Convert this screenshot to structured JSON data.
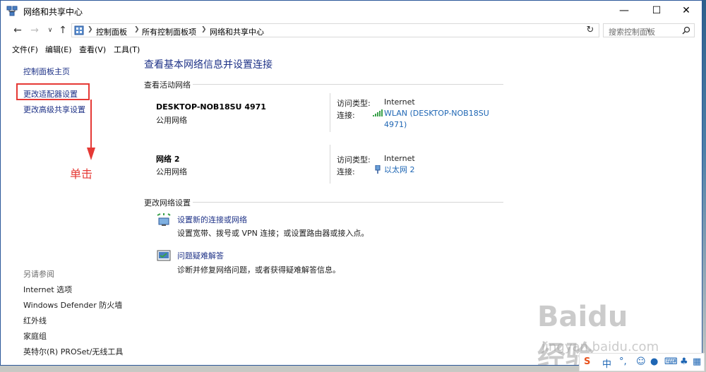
{
  "window": {
    "title": "网络和共享中心"
  },
  "address": {
    "crumbs": [
      "控制面板",
      "所有控制面板项",
      "网络和共享中心"
    ],
    "search_placeholder": "搜索控制面板"
  },
  "menu": [
    "文件(F)",
    "编辑(E)",
    "查看(V)",
    "工具(T)"
  ],
  "sidebar": {
    "home": "控制面板主页",
    "adapter": "更改适配器设置",
    "advanced_share": "更改高级共享设置",
    "see_also_head": "另请参阅",
    "see_also": [
      "Internet 选项",
      "Windows Defender 防火墙",
      "红外线",
      "家庭组",
      "英特尔(R) PROSet/无线工具"
    ]
  },
  "annotation": {
    "click_label": "单击",
    "color": "#e53935"
  },
  "main": {
    "title": "查看基本网络信息并设置连接",
    "active_head": "查看活动网络",
    "networks": [
      {
        "name": "DESKTOP-NOB18SU 4971",
        "type": "公用网络",
        "access_label": "访问类型:",
        "access_value": "Internet",
        "conn_label": "连接:",
        "conn_value": "WLAN (DESKTOP-NOB18SU 4971)",
        "conn_icon": "wifi-signal-icon"
      },
      {
        "name": "网络  2",
        "type": "公用网络",
        "access_label": "访问类型:",
        "access_value": "Internet",
        "conn_label": "连接:",
        "conn_value": "以太网 2",
        "conn_icon": "ethernet-icon"
      }
    ],
    "change_head": "更改网络设置",
    "tasks": [
      {
        "link": "设置新的连接或网络",
        "desc": "设置宽带、拨号或 VPN 连接；或设置路由器或接入点。",
        "icon": "new-connection-icon"
      },
      {
        "link": "问题疑难解答",
        "desc": "诊断并修复网络问题，或者获得疑难解答信息。",
        "icon": "troubleshoot-icon"
      }
    ]
  },
  "watermark": {
    "logo": "Baidu经验",
    "url": "jingyan.baidu.com"
  },
  "tray": {
    "ime": "中",
    "punct": "°,"
  }
}
